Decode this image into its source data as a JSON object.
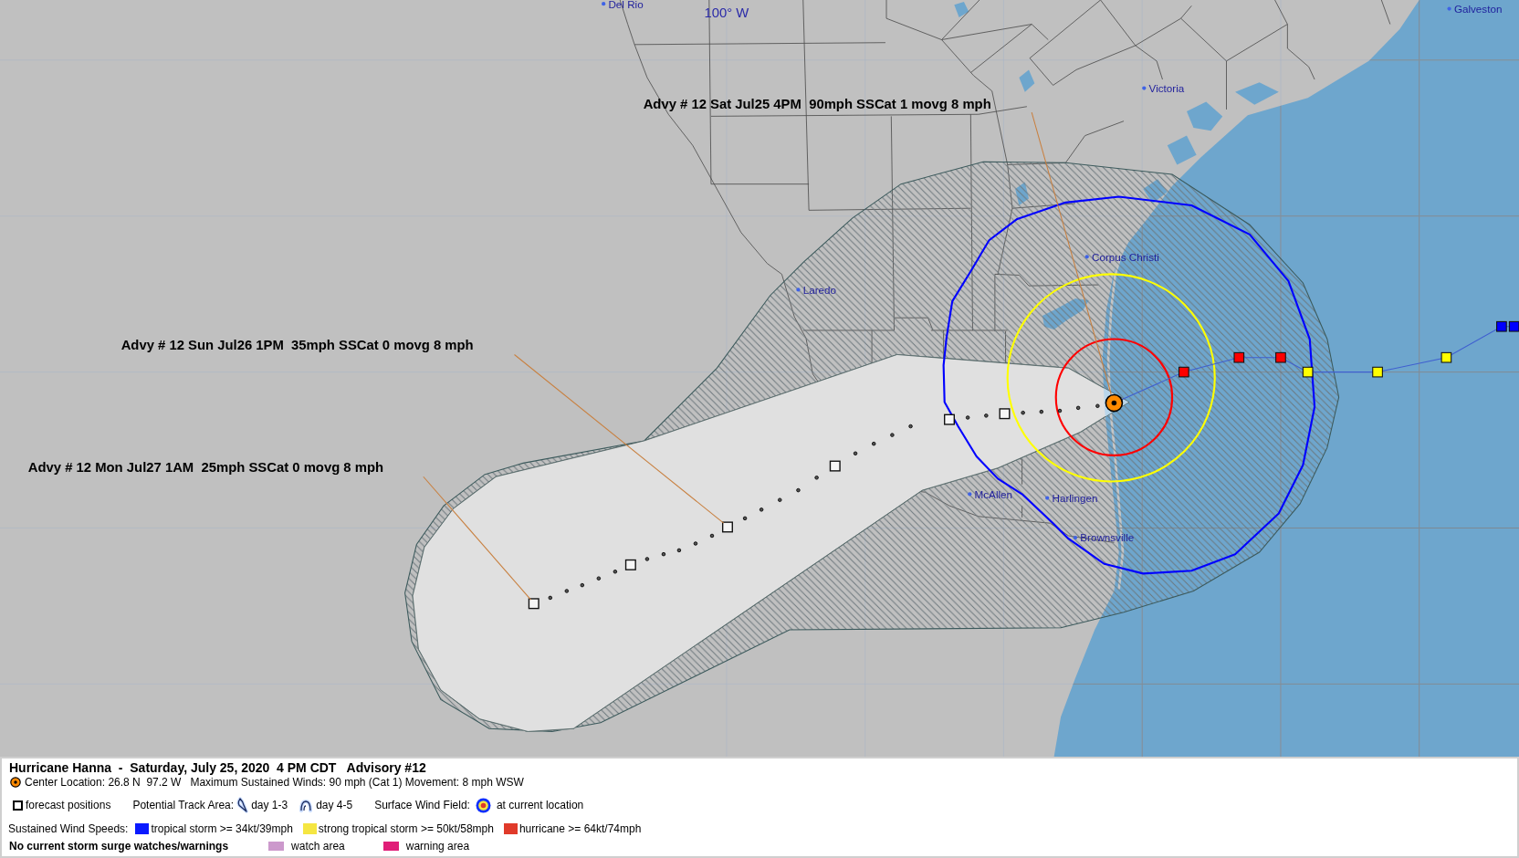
{
  "map": {
    "grid_labels": [
      {
        "text": "100° W"
      }
    ],
    "cities": [
      {
        "name": "Del Rio"
      },
      {
        "name": "Galveston"
      },
      {
        "name": "Victoria"
      },
      {
        "name": "Corpus Christi"
      },
      {
        "name": "Laredo"
      },
      {
        "name": "McAllen"
      },
      {
        "name": "Harlingen"
      },
      {
        "name": "Brownsville"
      }
    ],
    "advisory_labels": [
      {
        "text": "Advy # 12 Sat Jul25 4PM  90mph SSCat 1 movg 8 mph"
      },
      {
        "text": "Advy # 12 Sun Jul26 1PM  35mph SSCat 0 movg 8 mph"
      },
      {
        "text": "Advy # 12 Mon Jul27 1AM  25mph SSCat 0 movg 8 mph"
      }
    ],
    "past_track": [
      {
        "color": "#ff0000"
      },
      {
        "color": "#ff0000"
      },
      {
        "color": "#ff0000"
      },
      {
        "color": "#ffff00"
      },
      {
        "color": "#ffff00"
      },
      {
        "color": "#ffff00"
      },
      {
        "color": "#0000ff"
      },
      {
        "color": "#0000ff"
      }
    ]
  },
  "legend": {
    "title": "Hurricane Hanna  -  Saturday, July 25, 2020  4 PM CDT   Advisory #12",
    "details": "Center Location: 26.8 N  97.2 W   Maximum Sustained Winds: 90 mph (Cat 1) Movement: 8 mph WSW",
    "symbols": [
      {
        "kind": "square",
        "label": "forecast positions"
      },
      {
        "kind": "heading",
        "label": "Potential Track Area:"
      },
      {
        "kind": "cone",
        "label": "day 1-3"
      },
      {
        "kind": "cone_open",
        "label": "day 4-5"
      },
      {
        "kind": "heading",
        "label": "Surface Wind Field:"
      },
      {
        "kind": "wind_field",
        "label": "at current location"
      }
    ],
    "wind_speeds": {
      "label": "Sustained Wind Speeds:",
      "items": [
        {
          "label": "tropical storm >= 34kt/39mph",
          "color": "#0a1aff"
        },
        {
          "label": "strong tropical storm >= 50kt/58mph",
          "color": "#f5e642"
        },
        {
          "label": "hurricane >= 64kt/74mph",
          "color": "#e03a2a"
        }
      ]
    },
    "surge": {
      "label": "No current storm surge watches/warnings",
      "items": [
        {
          "label": "watch area",
          "color": "#cc99cc"
        },
        {
          "label": "warning area",
          "color": "#e01e78"
        }
      ]
    }
  }
}
